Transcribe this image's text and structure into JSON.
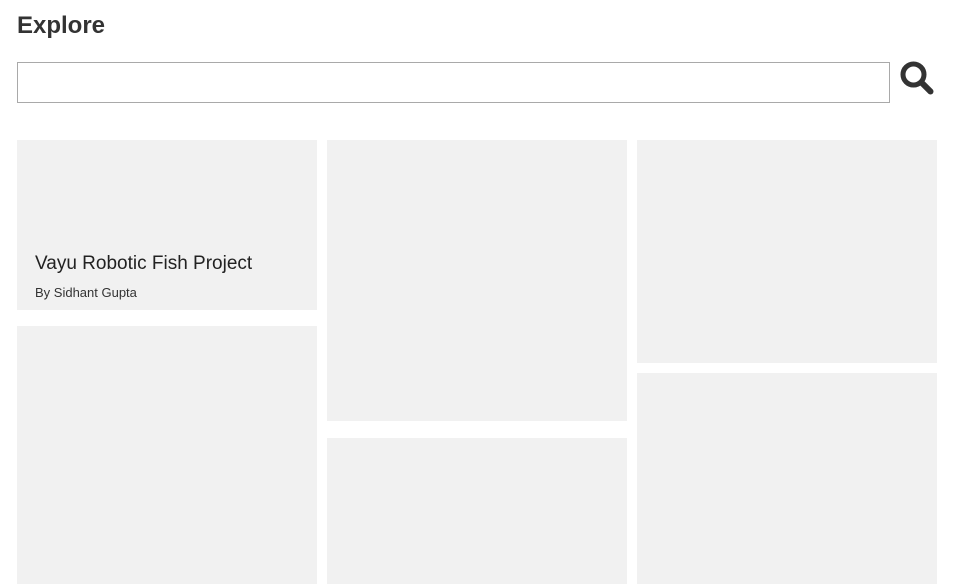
{
  "header": {
    "title": "Explore"
  },
  "search": {
    "value": "",
    "placeholder": "",
    "icon": "search-icon"
  },
  "cards": [
    {
      "title": "Vayu Robotic Fish Project",
      "author": "By Sidhant Gupta"
    },
    {
      "title": "",
      "author": ""
    },
    {
      "title": "",
      "author": ""
    },
    {
      "title": "",
      "author": ""
    },
    {
      "title": "",
      "author": ""
    },
    {
      "title": "",
      "author": ""
    }
  ],
  "colors": {
    "card_background": "#f1f1f1",
    "title_text": "#333333",
    "icon": "#333333",
    "input_border": "#a9a9a9"
  }
}
